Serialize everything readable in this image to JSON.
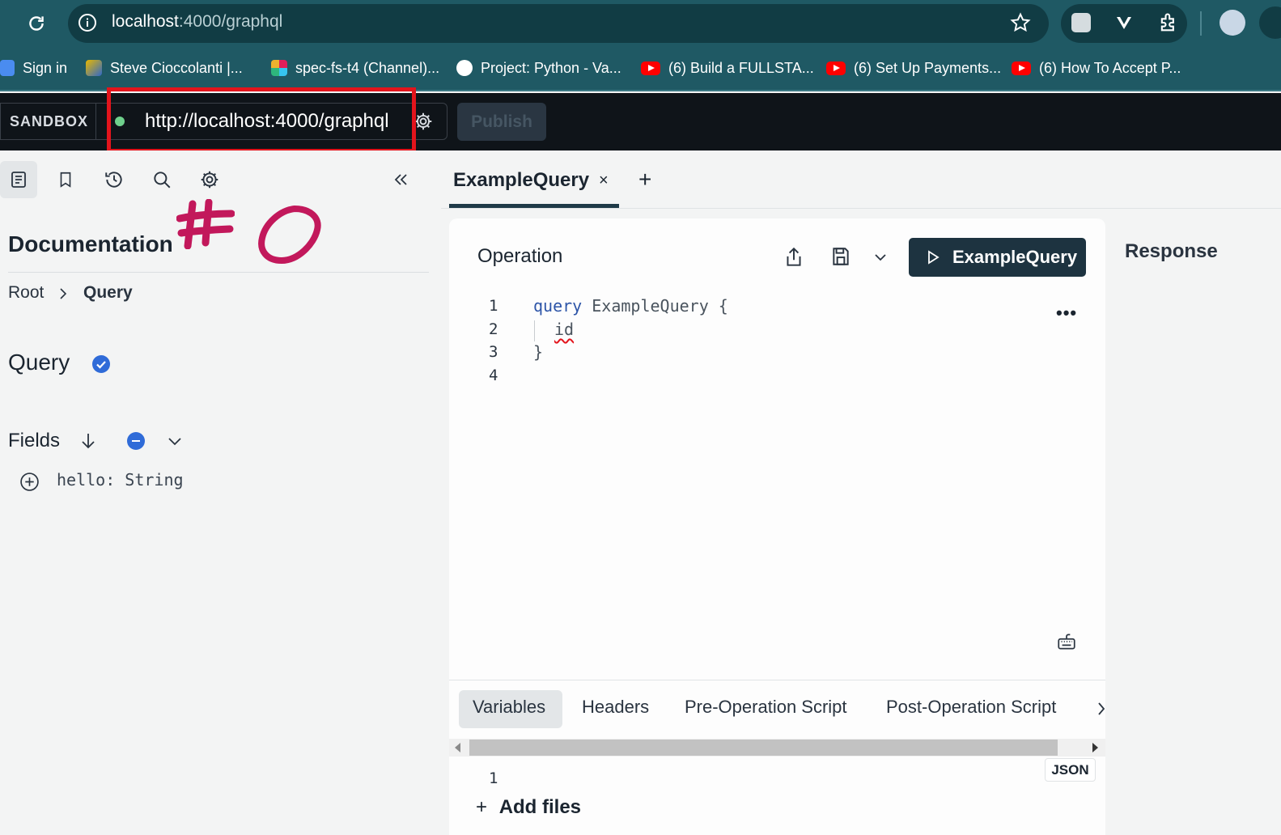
{
  "browser": {
    "url_host": "localhost",
    "url_path": ":4000/graphql",
    "bookmarks": [
      {
        "label": "Sign in"
      },
      {
        "label": "Steve Cioccolanti |..."
      },
      {
        "label": "spec-fs-t4 (Channel)..."
      },
      {
        "label": "Project: Python - Va..."
      },
      {
        "label": "(6) Build a FULLSTA..."
      },
      {
        "label": "(6) Set Up Payments..."
      },
      {
        "label": "(6) How To Accept P..."
      }
    ]
  },
  "header": {
    "sandbox_label": "SANDBOX",
    "endpoint": "http://localhost:4000/graphql",
    "publish_label": "Publish"
  },
  "docs": {
    "title": "Documentation",
    "breadcrumb": [
      "Root",
      "Query"
    ],
    "type_title": "Query",
    "fields_label": "Fields",
    "fields": [
      {
        "name": "hello:",
        "type": "String"
      }
    ]
  },
  "tabs": [
    {
      "label": "ExampleQuery",
      "close": "×",
      "active": true
    }
  ],
  "tab_add": "+",
  "operation": {
    "title": "Operation",
    "run_label": "ExampleQuery",
    "more": "•••",
    "line_numbers": [
      "1",
      "2",
      "3",
      "4"
    ],
    "code": {
      "line1_kw": "query",
      "line1_rest": " ExampleQuery {",
      "line2": "id",
      "line3": "}"
    }
  },
  "bottom_tabs": [
    "Variables",
    "Headers",
    "Pre-Operation Script",
    "Post-Operation Script"
  ],
  "variables": {
    "line_numbers": [
      "1"
    ],
    "format_badge": "JSON",
    "add_files_icon": "+",
    "add_files_label": "Add files"
  },
  "response": {
    "title": "Response"
  },
  "colors": {
    "chrome": "#1f5964",
    "app_header": "#0f1419",
    "run_button": "#1d3340",
    "annotation": "#c2185b",
    "highlight_box": "#e3141c"
  },
  "icons": [
    "reload-icon",
    "info-icon",
    "star-icon",
    "extension-icon",
    "profile-avatar",
    "docs-icon",
    "bookmark-icon",
    "history-icon",
    "search-icon",
    "gear-icon",
    "collapse-icon",
    "share-icon",
    "save-icon",
    "chevron-down-icon",
    "play-icon",
    "keyboard-icon",
    "arrow-down-icon",
    "plus-circle-icon"
  ]
}
